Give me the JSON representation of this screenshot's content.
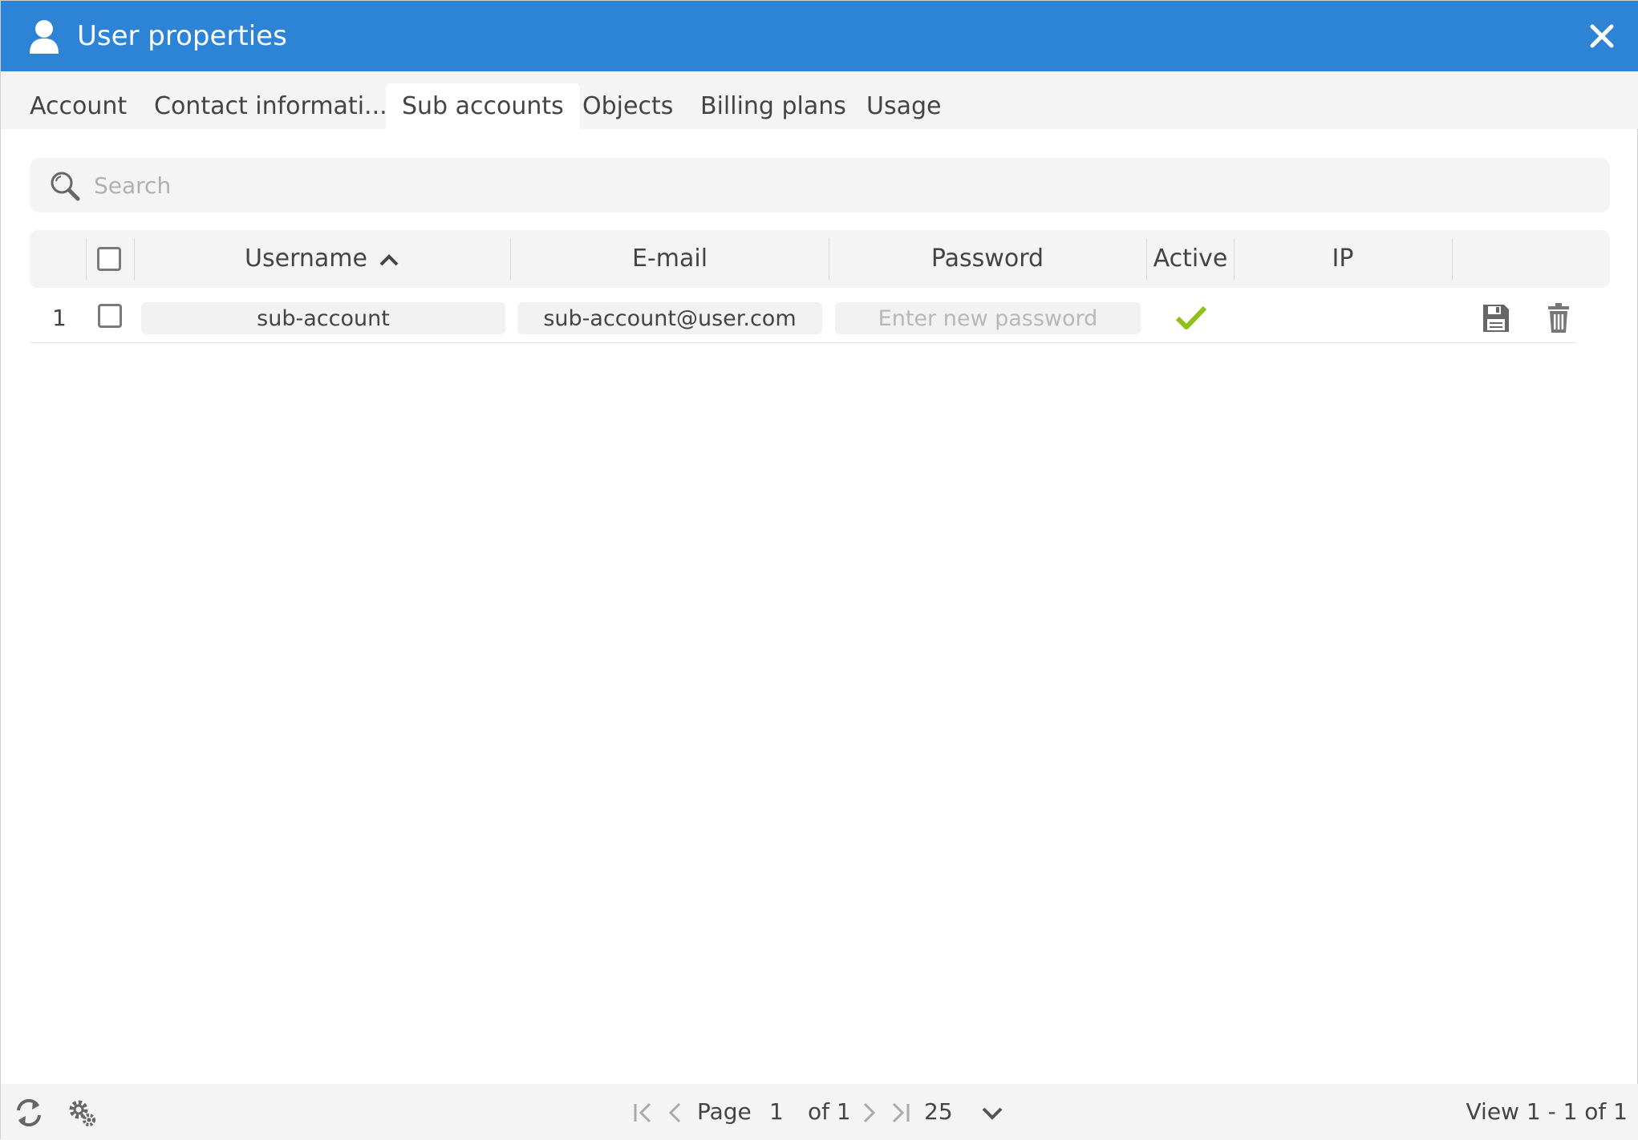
{
  "window": {
    "title": "User properties",
    "icon": "user-icon",
    "close_icon": "close-icon"
  },
  "tabs": [
    {
      "label": "Account"
    },
    {
      "label": "Contact informati..."
    },
    {
      "label": "Sub accounts",
      "active": true
    },
    {
      "label": "Objects"
    },
    {
      "label": "Billing plans"
    },
    {
      "label": "Usage"
    }
  ],
  "search": {
    "placeholder": "Search",
    "value": "",
    "icon": "search-icon"
  },
  "table": {
    "columns": [
      "Username",
      "E-mail",
      "Password",
      "Active",
      "IP"
    ],
    "sort": {
      "column": "Username",
      "direction": "ascending",
      "icon": "chevron-up-icon"
    },
    "rows": [
      {
        "index": "1",
        "username": "sub-account",
        "email": "sub-account@user.com",
        "password": "",
        "password_placeholder": "Enter new password",
        "active": true,
        "ip": ""
      }
    ]
  },
  "footer": {
    "refresh_icon": "refresh-icon",
    "settings_icon": "settings-icon",
    "page_label": "Page",
    "page_value": "1",
    "page_total": "of 1",
    "page_size": "25",
    "view_text": "View 1 - 1 of 1"
  },
  "colors": {
    "titlebar": "#2d84d6",
    "active_check": "#8cc21a",
    "panel_bg": "#f4f4f4"
  }
}
